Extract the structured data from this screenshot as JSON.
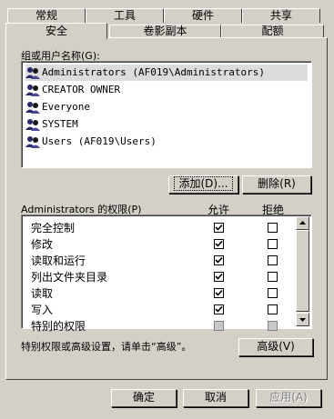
{
  "tabs_back": [
    "常规",
    "工具",
    "硬件",
    "共享"
  ],
  "tabs_front": [
    "安全",
    "卷影副本",
    "配额"
  ],
  "groups": {
    "label": "组或用户名称(G):",
    "items": [
      "Administrators (AF019\\Administrators)",
      "CREATOR OWNER",
      "Everyone",
      "SYSTEM",
      "Users (AF019\\Users)"
    ]
  },
  "add_button": "添加(D)...",
  "remove_button": "删除(R)",
  "permissions": {
    "label": "Administrators 的权限(P)",
    "allow_header": "允许",
    "deny_header": "拒绝",
    "rows": [
      {
        "name": "完全控制",
        "allow": true,
        "deny": false,
        "gray": false
      },
      {
        "name": "修改",
        "allow": true,
        "deny": false,
        "gray": false
      },
      {
        "name": "读取和运行",
        "allow": true,
        "deny": false,
        "gray": false
      },
      {
        "name": "列出文件夹目录",
        "allow": true,
        "deny": false,
        "gray": false
      },
      {
        "name": "读取",
        "allow": true,
        "deny": false,
        "gray": false
      },
      {
        "name": "写入",
        "allow": true,
        "deny": false,
        "gray": false
      },
      {
        "name": "特别的权限",
        "allow": false,
        "deny": false,
        "gray": true
      }
    ]
  },
  "advanced_text": "特别权限或高级设置，请单击“高级”。",
  "advanced_button": "高级(V)",
  "ok_button": "确定",
  "cancel_button": "取消",
  "apply_button": "应用(A)"
}
